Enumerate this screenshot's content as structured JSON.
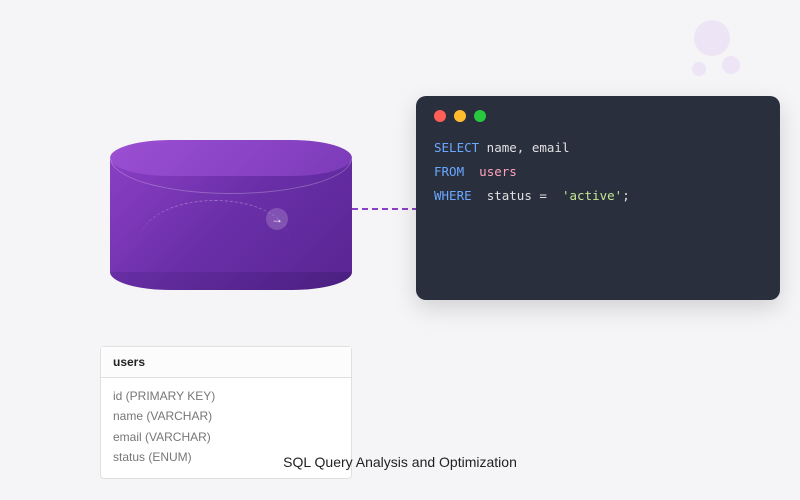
{
  "caption": "SQL Query Analysis and Optimization",
  "code": {
    "line1": {
      "kw": "SELECT",
      "rest": " name, email"
    },
    "line2": {
      "kw": "FROM",
      "ident": "users"
    },
    "line3": {
      "kw": "WHERE",
      "col": "status",
      "op": "=",
      "val": "'active'",
      "end": ";"
    }
  },
  "schema": {
    "table_name": "users",
    "columns": [
      "id (PRIMARY KEY)",
      "name (VARCHAR)",
      "email (VARCHAR)",
      "status (ENUM)"
    ]
  },
  "arrow_glyph": "→"
}
